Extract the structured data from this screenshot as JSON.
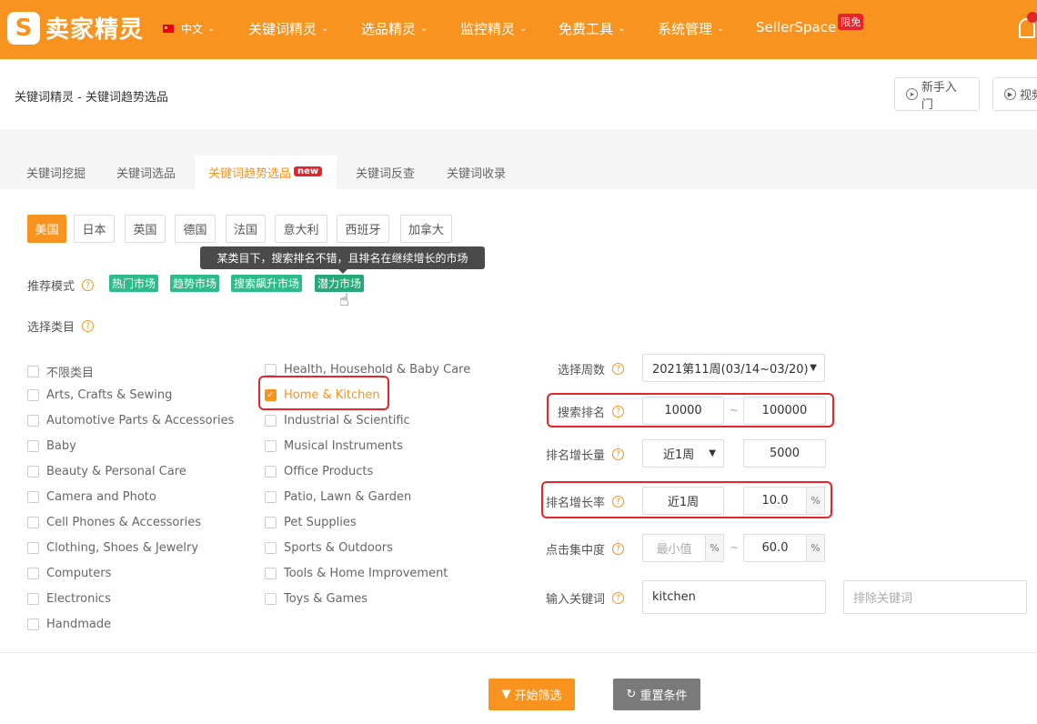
{
  "brand": {
    "logo_mark": "S",
    "name": "卖家精灵"
  },
  "nav": {
    "lang": "中文",
    "items": [
      "关键词精灵",
      "选品精灵",
      "监控精灵",
      "免费工具",
      "系统管理"
    ],
    "sellerspace": "SellerSpace",
    "sellerspace_badge": "限免"
  },
  "breadcrumb": "关键词精灵 - 关键词趋势选品",
  "header_buttons": {
    "newbie": "新手入门",
    "video": "视频"
  },
  "tabs": [
    "关键词挖掘",
    "关键词选品",
    "关键词趋势选品",
    "关键词反查",
    "关键词收录"
  ],
  "tab_new_badge": "new",
  "countries": [
    "美国",
    "日本",
    "英国",
    "德国",
    "法国",
    "意大利",
    "西班牙",
    "加拿大"
  ],
  "tooltip": "某类目下，搜索排名不错，且排名在继续增长的市场",
  "recommend": {
    "label": "推荐模式",
    "modes": [
      "热门市场",
      "趋势市场",
      "搜索飙升市场",
      "潜力市场"
    ]
  },
  "category_label": "选择类目",
  "categories_col1": [
    "不限类目",
    "Arts, Crafts & Sewing",
    "Automotive Parts & Accessories",
    "Baby",
    "Beauty & Personal Care",
    "Camera and Photo",
    "Cell Phones & Accessories",
    "Clothing, Shoes & Jewelry",
    "Computers",
    "Electronics",
    "Handmade"
  ],
  "categories_col2": [
    "Health, Household & Baby Care",
    "Home & Kitchen",
    "Industrial & Scientific",
    "Musical Instruments",
    "Office Products",
    "Patio, Lawn & Garden",
    "Pet Supplies",
    "Sports & Outdoors",
    "Tools & Home Improvement",
    "Toys & Games"
  ],
  "form": {
    "week_label": "选择周数",
    "week_value": "2021第11周(03/14~03/20)",
    "rank_label": "搜索排名",
    "rank_min": "10000",
    "rank_max": "100000",
    "growth_label": "排名增长量",
    "growth_period": "近1周",
    "growth_value": "5000",
    "rate_label": "排名增长率",
    "rate_period": "近1周",
    "rate_value": "10.0",
    "click_label": "点击集中度",
    "click_min_placeholder": "最小值",
    "click_max": "60.0",
    "percent": "%",
    "dash": "~",
    "keyword_label": "输入关键词",
    "keyword_value": "kitchen",
    "exclude_placeholder": "排除关键词"
  },
  "buttons": {
    "start": "开始筛选",
    "reset": "重置条件"
  },
  "colors": {
    "brand": "#f7931e",
    "accent_green": "#2dbb8a",
    "highlight_red": "#e8232a"
  }
}
